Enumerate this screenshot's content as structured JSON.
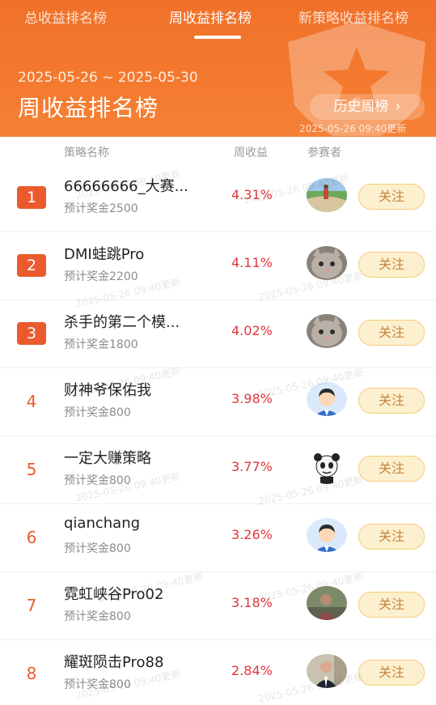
{
  "tabs": [
    {
      "label": "总收益排名榜",
      "active": false
    },
    {
      "label": "周收益排名榜",
      "active": true
    },
    {
      "label": "新策略收益排名榜",
      "active": false
    }
  ],
  "header": {
    "date_range": "2025-05-26 ~ 2025-05-30",
    "title": "周收益排名榜",
    "history_button": "历史周榜",
    "history_chevron": "›",
    "update_time": "2025-05-26 09:40更新"
  },
  "columns": {
    "strategy": "策略名称",
    "weekly_return": "周收益",
    "participant": "参赛者"
  },
  "watermark_text": "2025-05-26 09:40更新",
  "follow_label": "关注",
  "rows": [
    {
      "rank": "1",
      "name": "66666666_大赛...",
      "prize": "预计奖金2500",
      "return": "4.31%",
      "avatar": "landscape-photo-avatar"
    },
    {
      "rank": "2",
      "name": "DMI蛙跳Pro",
      "prize": "预计奖金2200",
      "return": "4.11%",
      "avatar": "cat-avatar"
    },
    {
      "rank": "3",
      "name": "杀手的第二个模...",
      "prize": "预计奖金1800",
      "return": "4.02%",
      "avatar": "cat-avatar"
    },
    {
      "rank": "4",
      "name": "财神爷保佑我",
      "prize": "预计奖金800",
      "return": "3.98%",
      "avatar": "cartoon-man-avatar"
    },
    {
      "rank": "5",
      "name": "一定大赚策略",
      "prize": "预计奖金800",
      "return": "3.77%",
      "avatar": "panda-meme-avatar"
    },
    {
      "rank": "6",
      "name": "qianchang",
      "prize": "预计奖金800",
      "return": "3.26%",
      "avatar": "cartoon-man-avatar"
    },
    {
      "rank": "7",
      "name": "霓虹峡谷Pro02",
      "prize": "预计奖金800",
      "return": "3.18%",
      "avatar": "person-photo-avatar"
    },
    {
      "rank": "8",
      "name": "耀斑陨击Pro88",
      "prize": "预计奖金800",
      "return": "2.84%",
      "avatar": "man-in-suit-avatar"
    }
  ],
  "colors": {
    "header_orange": "#f47a2f",
    "rank_badge": "#eb5a2e",
    "return_red": "#e0363b",
    "follow_bg": "#fdf0cf",
    "follow_text": "#c8843a"
  }
}
